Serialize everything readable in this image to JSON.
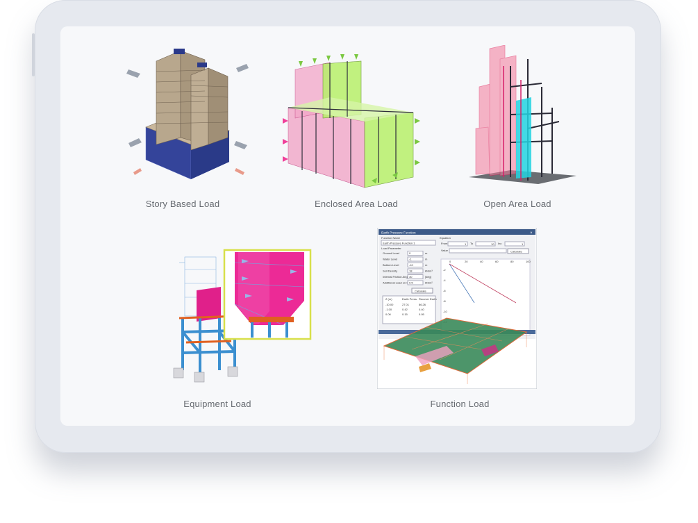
{
  "cards": [
    {
      "label": "Story Based Load"
    },
    {
      "label": "Enclosed Area Load"
    },
    {
      "label": "Open Area Load"
    },
    {
      "label": "Equipment Load"
    },
    {
      "label": "Function Load"
    }
  ],
  "function_dialog": {
    "title": "Earth Pressure Function",
    "function_name_label": "Function Name",
    "function_name_value": "Earth Pressure Function 1",
    "equation_label": "Equation",
    "from_label": "From",
    "from_value": "1",
    "to_label": "To",
    "to_value": "10",
    "inc_label": "Inc",
    "inc_value": "1",
    "value_label": "Value",
    "calculate_label": "Calculate",
    "load_parameter_label": "Load Parameter",
    "params": [
      {
        "label": "Ground Level",
        "value": "0",
        "unit": "m"
      },
      {
        "label": "Water Level",
        "value": "-1",
        "unit": "m"
      },
      {
        "label": "Bottom Level",
        "value": "-10",
        "unit": "m"
      },
      {
        "label": "Soil Density",
        "value": "18",
        "unit": "kN/m³"
      },
      {
        "label": "Internal Friction Angle",
        "value": "30",
        "unit": "[deg]"
      },
      {
        "label": "Additional Load on Ground",
        "value": "0.5",
        "unit": "kN/m²"
      }
    ],
    "table_headers": [
      "Z (m)",
      "Earth Press.",
      "Recover Earth"
    ],
    "table_rows": [
      [
        "-10.00",
        "27.01",
        "86.26"
      ],
      [
        "-1.00",
        "0.42",
        "0.40"
      ],
      [
        "0.00",
        "0.15",
        "0.05"
      ]
    ],
    "graph_x_ticks": [
      "0",
      "20",
      "40",
      "60",
      "80",
      "100"
    ],
    "graph_y_ticks": [
      "-2",
      "-4",
      "-6",
      "-8",
      "-10",
      "-12"
    ]
  },
  "colors": {
    "tablet": "#e6e9ef",
    "screen": "#f7f8fa",
    "caption": "#666a70",
    "steel_blue": "#3b8fd0",
    "magenta": "#e0208a",
    "lime": "#b8f06a",
    "pink_load": "#f2a6c8"
  },
  "icons": [
    "story-building-icon",
    "enclosed-area-icon",
    "open-area-icon",
    "equipment-icon",
    "function-chart-icon"
  ]
}
